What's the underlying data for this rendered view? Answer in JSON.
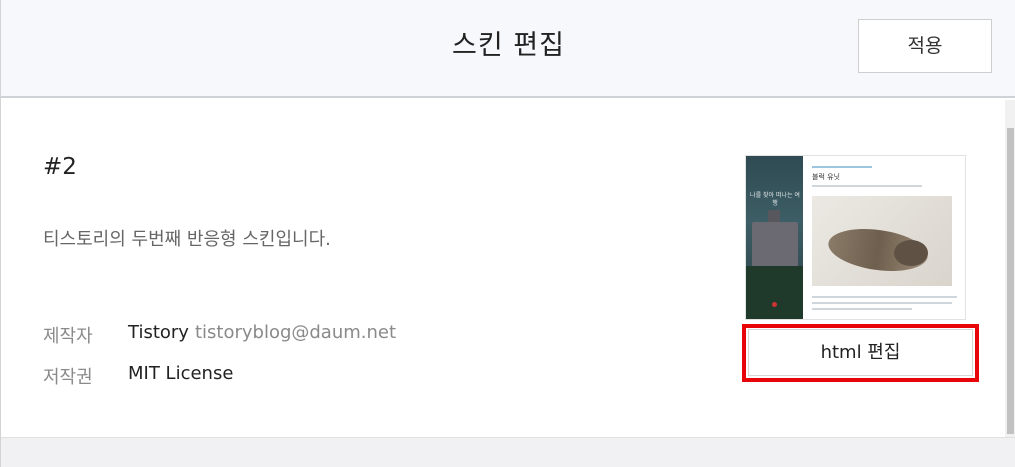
{
  "header": {
    "title": "스킨 편집",
    "apply_label": "적용"
  },
  "skin": {
    "name": "#2",
    "description": "티스토리의 두번째 반응형 스킨입니다.",
    "author_label": "제작자",
    "author_name": "Tistory",
    "author_email": "tistoryblog@daum.net",
    "license_label": "저작권",
    "license_value": "MIT License"
  },
  "preview": {
    "left_caption": "나를 찾아 떠나는 여행",
    "post_title": "블럭 유닛",
    "image_subject": "sleeping cat"
  },
  "actions": {
    "html_edit_label": "html 편집"
  },
  "colors": {
    "highlight": "#e8050a",
    "header_bg": "#f7f8fb"
  }
}
